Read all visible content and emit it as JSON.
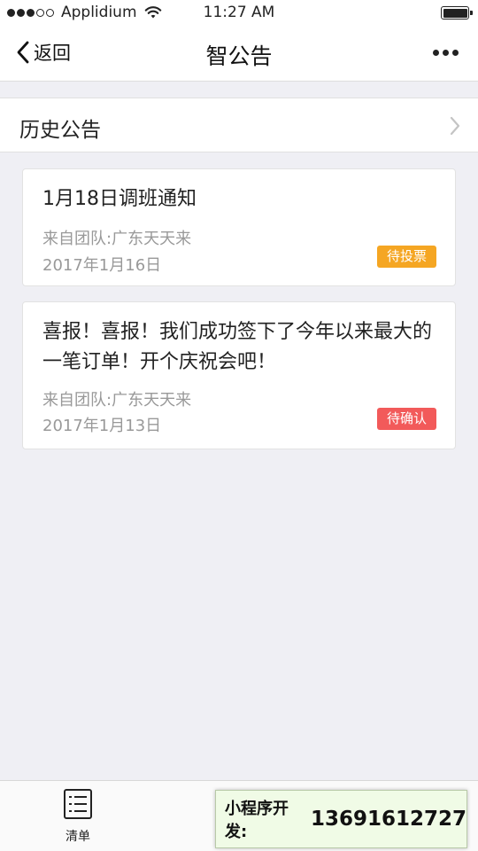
{
  "status_bar": {
    "carrier": "Applidium",
    "time": "11:27 AM",
    "signal_filled": 3,
    "signal_total": 5
  },
  "nav": {
    "back_label": "返回",
    "title": "智公告"
  },
  "history": {
    "label": "历史公告"
  },
  "announcements": [
    {
      "title": "1月18日调班通知",
      "source": "来自团队:广东天天来",
      "date": "2017年1月16日",
      "status": "待投票",
      "status_color": "#f5a623"
    },
    {
      "title": "喜报！喜报！我们成功签下了今年以来最大的一笔订单！开个庆祝会吧！",
      "source": "来自团队:广东天天来",
      "date": "2017年1月13日",
      "status": "待确认",
      "status_color": "#f25a5a"
    }
  ],
  "tab_bar": {
    "items": [
      {
        "label": "清单",
        "icon": "list-icon"
      }
    ]
  },
  "promo": {
    "label": "小程序开发:",
    "phone": "13691612727"
  }
}
